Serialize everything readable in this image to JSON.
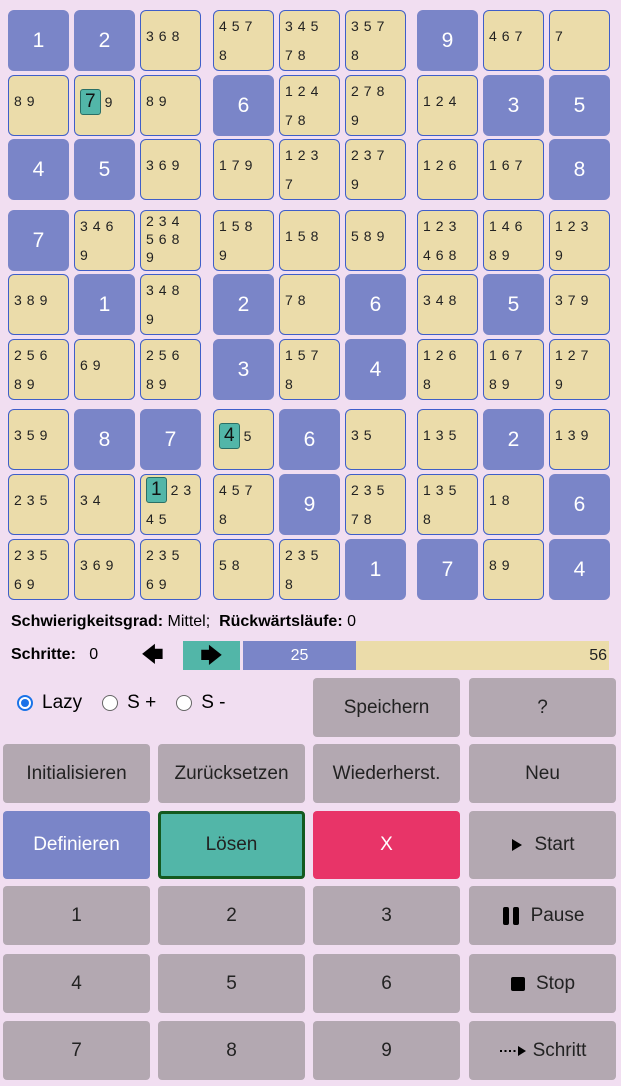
{
  "board": {
    "rows": [
      [
        {
          "v": "1"
        },
        {
          "v": "2"
        },
        {
          "c": [
            "368"
          ]
        },
        {
          "c": [
            "457",
            "8"
          ]
        },
        {
          "c": [
            "345",
            "78"
          ]
        },
        {
          "c": [
            "357",
            "8"
          ]
        },
        {
          "v": "9"
        },
        {
          "c": [
            "467"
          ]
        },
        {
          "c": [
            "7"
          ]
        }
      ],
      [
        {
          "c": [
            "89"
          ]
        },
        {
          "h": "7",
          "c": [
            "9"
          ]
        },
        {
          "c": [
            "89"
          ]
        },
        {
          "v": "6"
        },
        {
          "c": [
            "124",
            "78"
          ]
        },
        {
          "c": [
            "278",
            "9"
          ]
        },
        {
          "c": [
            "124"
          ]
        },
        {
          "v": "3"
        },
        {
          "v": "5"
        }
      ],
      [
        {
          "v": "4"
        },
        {
          "v": "5"
        },
        {
          "c": [
            "369"
          ]
        },
        {
          "c": [
            "179"
          ]
        },
        {
          "c": [
            "123",
            "7"
          ]
        },
        {
          "c": [
            "237",
            "9"
          ]
        },
        {
          "c": [
            "126"
          ]
        },
        {
          "c": [
            "167"
          ]
        },
        {
          "v": "8"
        }
      ],
      [
        {
          "v": "7"
        },
        {
          "c": [
            "346",
            "9"
          ]
        },
        {
          "c": [
            "234",
            "568",
            "9"
          ]
        },
        {
          "c": [
            "158",
            "9"
          ]
        },
        {
          "c": [
            "158"
          ]
        },
        {
          "c": [
            "589"
          ]
        },
        {
          "c": [
            "123",
            "468"
          ]
        },
        {
          "c": [
            "146",
            "89"
          ]
        },
        {
          "c": [
            "123",
            "9"
          ]
        }
      ],
      [
        {
          "c": [
            "389"
          ]
        },
        {
          "v": "1"
        },
        {
          "c": [
            "348",
            "9"
          ]
        },
        {
          "v": "2"
        },
        {
          "c": [
            "78"
          ]
        },
        {
          "v": "6"
        },
        {
          "c": [
            "348"
          ]
        },
        {
          "v": "5"
        },
        {
          "c": [
            "379"
          ]
        }
      ],
      [
        {
          "c": [
            "256",
            "89"
          ]
        },
        {
          "c": [
            "69"
          ]
        },
        {
          "c": [
            "256",
            "89"
          ]
        },
        {
          "v": "3"
        },
        {
          "c": [
            "157",
            "8"
          ]
        },
        {
          "v": "4"
        },
        {
          "c": [
            "126",
            "8"
          ]
        },
        {
          "c": [
            "167",
            "89"
          ]
        },
        {
          "c": [
            "127",
            "9"
          ]
        }
      ],
      [
        {
          "c": [
            "359"
          ]
        },
        {
          "v": "8"
        },
        {
          "v": "7"
        },
        {
          "h": "4",
          "c": [
            "5"
          ]
        },
        {
          "v": "6"
        },
        {
          "c": [
            "35"
          ]
        },
        {
          "c": [
            "135"
          ]
        },
        {
          "v": "2"
        },
        {
          "c": [
            "139"
          ]
        }
      ],
      [
        {
          "c": [
            "235"
          ]
        },
        {
          "c": [
            "34"
          ]
        },
        {
          "h": "1",
          "c": [
            "23",
            "45"
          ]
        },
        {
          "c": [
            "457",
            "8"
          ]
        },
        {
          "v": "9"
        },
        {
          "c": [
            "235",
            "78"
          ]
        },
        {
          "c": [
            "135",
            "8"
          ]
        },
        {
          "c": [
            "18"
          ]
        },
        {
          "v": "6"
        }
      ],
      [
        {
          "c": [
            "235",
            "69"
          ]
        },
        {
          "c": [
            "369"
          ]
        },
        {
          "c": [
            "235",
            "69"
          ]
        },
        {
          "c": [
            "58"
          ]
        },
        {
          "c": [
            "235",
            "8"
          ]
        },
        {
          "v": "1"
        },
        {
          "v": "7"
        },
        {
          "c": [
            "89"
          ]
        },
        {
          "v": "4"
        }
      ]
    ]
  },
  "status": {
    "difficulty_label": "Schwierigkeitsgrad:",
    "difficulty_value": "Mittel;",
    "backtracks_label": "Rückwärtsläufe:",
    "backtracks_value": "0",
    "steps_label": "Schritte:",
    "steps_value": "0"
  },
  "progress": {
    "left_arrow": "🡄",
    "right_arrow": "🡆",
    "filled": 25,
    "remaining": 56,
    "total": 81
  },
  "modes": {
    "lazy": "Lazy",
    "s_plus": "S +",
    "s_minus": "S -",
    "selected": "lazy"
  },
  "buttons": {
    "save": "Speichern",
    "help": "?",
    "init": "Initialisieren",
    "reset": "Zurücksetzen",
    "restore": "Wiederherst.",
    "new": "Neu",
    "define": "Definieren",
    "solve": "Lösen",
    "clear": "X",
    "start": "Start",
    "pause": "Pause",
    "stop": "Stop",
    "step": "Schritt",
    "digits": [
      "1",
      "2",
      "3",
      "4",
      "5",
      "6",
      "7",
      "8",
      "9"
    ]
  },
  "icons": {
    "start": "play-icon",
    "pause": "pause-icon",
    "stop": "stop-icon",
    "step": "dotted-arrow-icon"
  },
  "colors": {
    "background": "#f1def1",
    "given": "#7a85c8",
    "candidate": "#ebdcaa",
    "highlight": "#52b6a8",
    "define": "#7a85c8",
    "solve": "#52b6a8",
    "clear": "#e83468",
    "button": "#b3a8b1"
  }
}
